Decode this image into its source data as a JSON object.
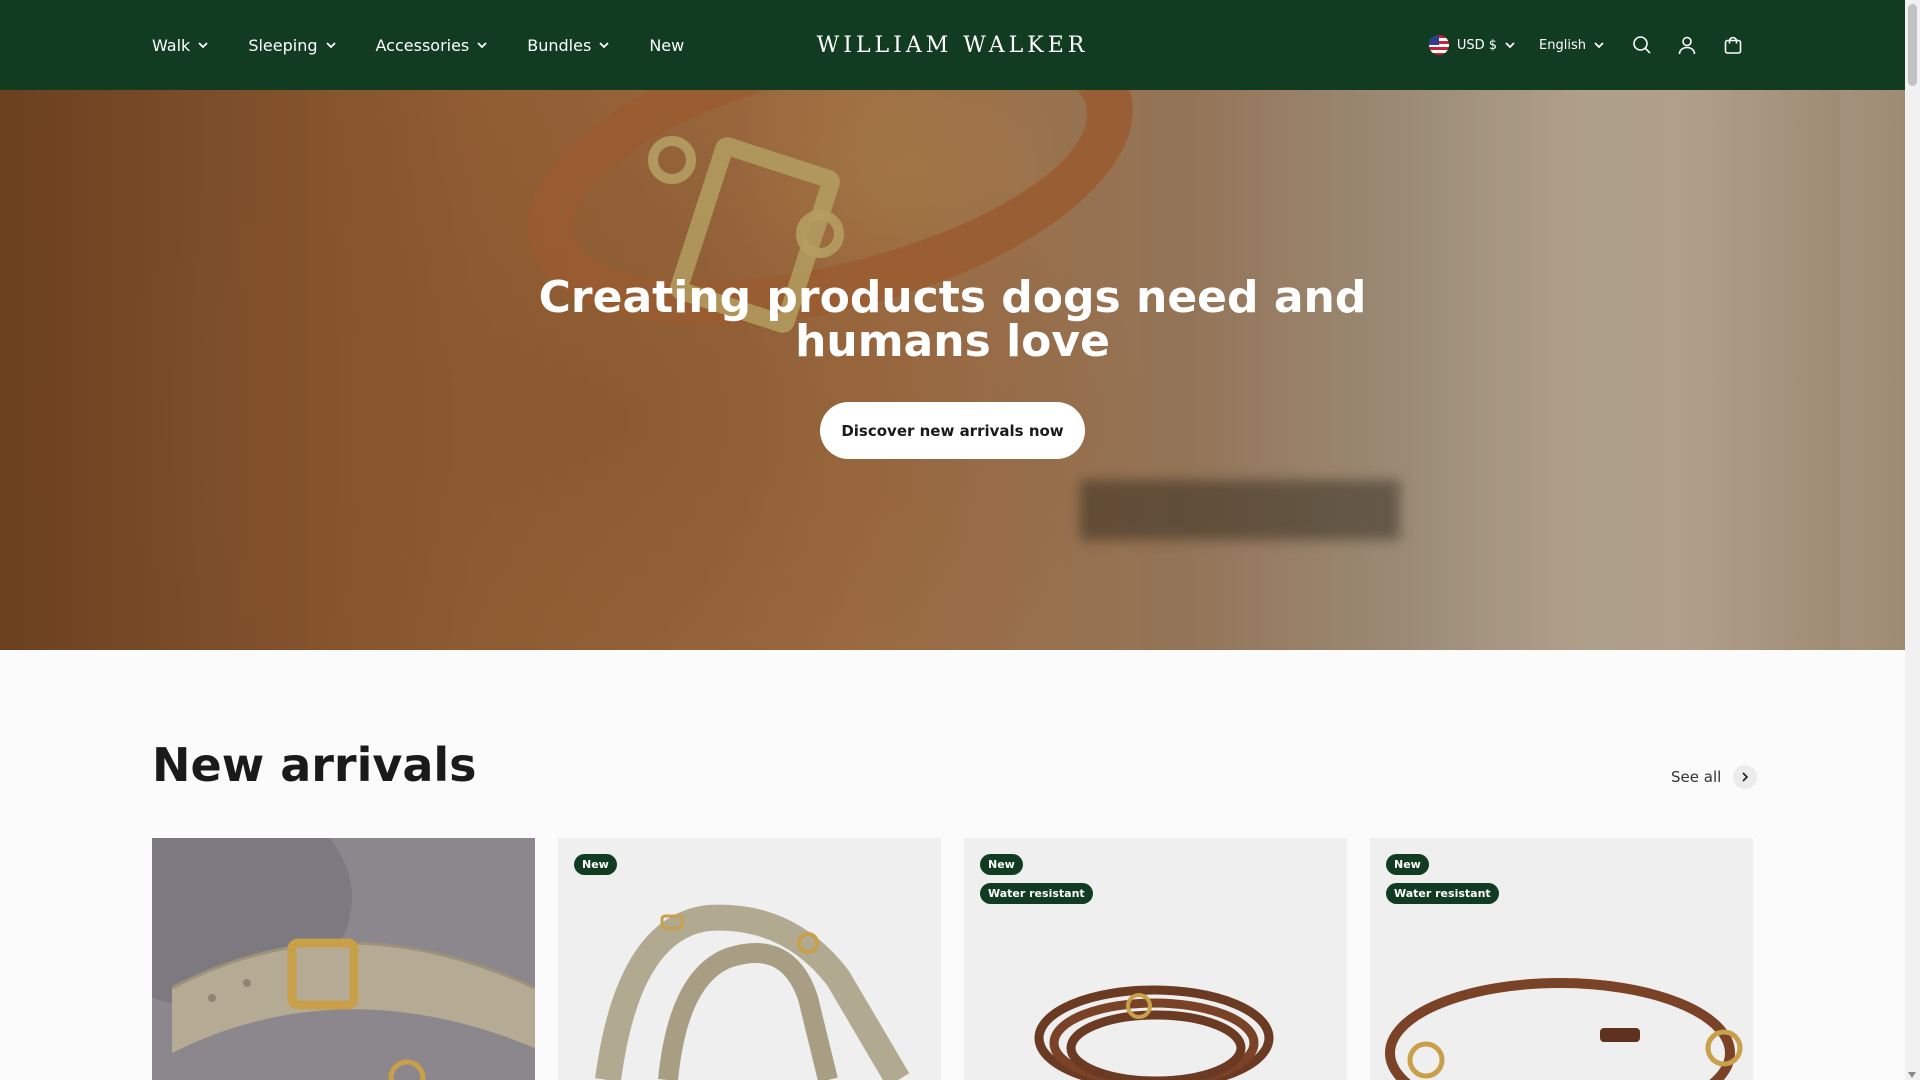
{
  "header": {
    "brand": "WILLIAM WALKER",
    "nav": [
      {
        "label": "Walk",
        "has_dropdown": true
      },
      {
        "label": "Sleeping",
        "has_dropdown": true
      },
      {
        "label": "Accessories",
        "has_dropdown": true
      },
      {
        "label": "Bundles",
        "has_dropdown": true
      },
      {
        "label": "New",
        "has_dropdown": false
      }
    ],
    "currency": "USD $",
    "language": "English",
    "icons": [
      "search-icon",
      "account-icon",
      "cart-icon"
    ]
  },
  "hero": {
    "title_line1": "Creating products dogs need and",
    "title_line2": "humans love",
    "cta": "Discover new arrivals now"
  },
  "new_arrivals": {
    "title": "New arrivals",
    "see_all": "See all",
    "products": [
      {
        "badges": []
      },
      {
        "badges": [
          "New"
        ]
      },
      {
        "badges": [
          "New",
          "Water resistant"
        ]
      },
      {
        "badges": [
          "New",
          "Water resistant"
        ]
      }
    ]
  },
  "colors": {
    "header_bg": "#123c22",
    "badge_bg": "#123c22",
    "page_bg": "#fbfbfb"
  }
}
